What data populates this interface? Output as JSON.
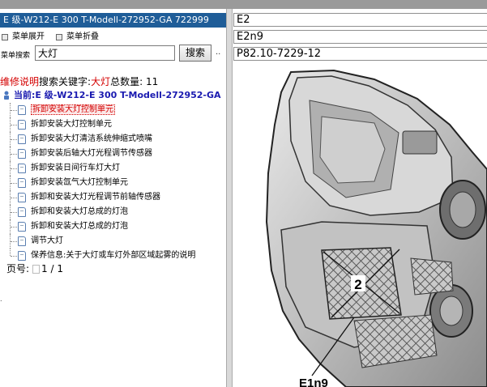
{
  "left": {
    "title": "E 级-W212-E 300 T-Modell-272952-GA 722999",
    "expand_label": "菜单展开",
    "collapse_label": "菜单折叠",
    "search": {
      "label": "菜单搜索",
      "value": "大灯",
      "button_label": "搜索",
      "more_label": ".."
    },
    "result": {
      "prefix": "维修说明",
      "keyword_label": "搜索关键字:",
      "keyword": "大灯",
      "count_label": "总数量:",
      "count": "11"
    },
    "current_node": "当前:E 级-W212-E 300 T-Modell-272952-GA",
    "items": [
      {
        "label": "拆卸安装大灯控制单元",
        "selected": true
      },
      {
        "label": "拆卸安装大灯控制单元",
        "selected": false
      },
      {
        "label": "拆卸安装大灯清洁系统伸缩式喷嘴",
        "selected": false
      },
      {
        "label": "拆卸安装后轴大灯光程调节传感器",
        "selected": false
      },
      {
        "label": "拆卸安装日间行车灯大灯",
        "selected": false
      },
      {
        "label": "拆卸安装氙气大灯控制单元",
        "selected": false
      },
      {
        "label": "拆卸和安装大灯光程调节前轴传感器",
        "selected": false
      },
      {
        "label": "拆卸和安装大灯总成的灯泡",
        "selected": false
      },
      {
        "label": "拆卸和安装大灯总成的灯泡",
        "selected": false
      },
      {
        "label": "调节大灯",
        "selected": false
      },
      {
        "label": "保养信息:关于大灯或车灯外部区域起雾的说明",
        "selected": false
      }
    ],
    "pager": {
      "label": "页号:",
      "value": "1 / 1"
    },
    "bottom_mark": "."
  },
  "right": {
    "field1": "E2",
    "field2": "E2n9",
    "field3": "P82.10-7229-12",
    "figure": {
      "callout_number": "2",
      "callout_label": "E1n9"
    }
  },
  "colors": {
    "title_bar": "#1f5d98",
    "highlight_red": "#d40000",
    "current_blue": "#1a1ab0",
    "top_strip": "#9a9a9a"
  }
}
